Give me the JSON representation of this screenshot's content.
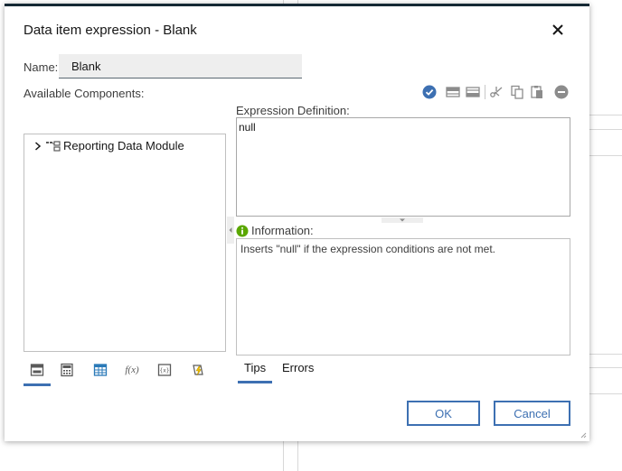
{
  "dialog": {
    "title": "Data item expression - Blank",
    "close_icon": "close-icon"
  },
  "name": {
    "label": "Name:",
    "value": "Blank"
  },
  "available": {
    "label": "Available Components:"
  },
  "toolbar": {
    "icons": [
      "validate-icon",
      "insert-row-above-icon",
      "insert-row-below-icon",
      "cut-icon",
      "copy-icon",
      "paste-icon",
      "remove-icon"
    ]
  },
  "tree": {
    "items": [
      {
        "label": "Reporting Data Module",
        "icon": "data-module-icon",
        "expanded": false
      }
    ]
  },
  "component_tabs": {
    "icons": [
      "source-icon",
      "calculator-icon",
      "table-icon",
      "functions-icon",
      "parameters-icon",
      "macro-icon"
    ],
    "functions_text": "f(x)",
    "active": 0
  },
  "expression": {
    "label": "Expression Definition:",
    "value": "null"
  },
  "information": {
    "label": "Information:",
    "text": "Inserts \"null\" if the expression conditions are not met."
  },
  "info_tabs": {
    "tips": "Tips",
    "errors": "Errors",
    "active": "tips"
  },
  "buttons": {
    "ok": "OK",
    "cancel": "Cancel"
  },
  "colors": {
    "accent": "#3d70b2",
    "dark_bar": "#152935",
    "info_green": "#5aa700"
  }
}
